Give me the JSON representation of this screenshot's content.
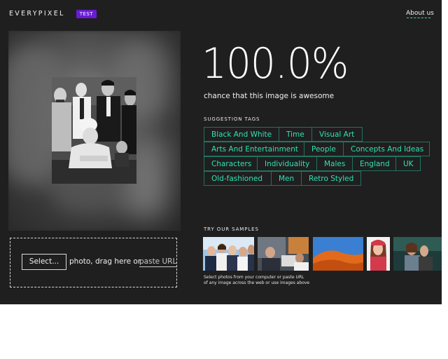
{
  "header": {
    "logo": "EVERYPIXEL",
    "badge": "TEST",
    "about_link": "About us"
  },
  "result": {
    "score": "100.0%",
    "caption": "chance that this image is awesome"
  },
  "suggestion_tags": {
    "title": "SUGGESTION TAGS",
    "tags": [
      "Black And White",
      "Time",
      "Visual Art",
      "Arts And Entertainment",
      "People",
      "Concepts And Ideas",
      "Characters",
      "Individuality",
      "Males",
      "England",
      "UK",
      "Old-fashioned",
      "Men",
      "Retro Styled"
    ]
  },
  "upload": {
    "select_label": "Select...",
    "text": "photo, drag here or",
    "paste_label": "paste URL"
  },
  "samples": {
    "title": "TRY OUR SAMPLES",
    "items": [
      "business-team-sample",
      "office-workers-sample",
      "desert-dunes-sample",
      "smiling-woman-sample",
      "couple-sample"
    ],
    "note_line1": "Select photos from your computer or paste URL",
    "note_line2": "of any image across the web or use images above"
  },
  "colors": {
    "background": "#1f1f1f",
    "accent": "#2fe2b4",
    "tag_border": "#23715f",
    "badge": "#6a1bd6"
  }
}
